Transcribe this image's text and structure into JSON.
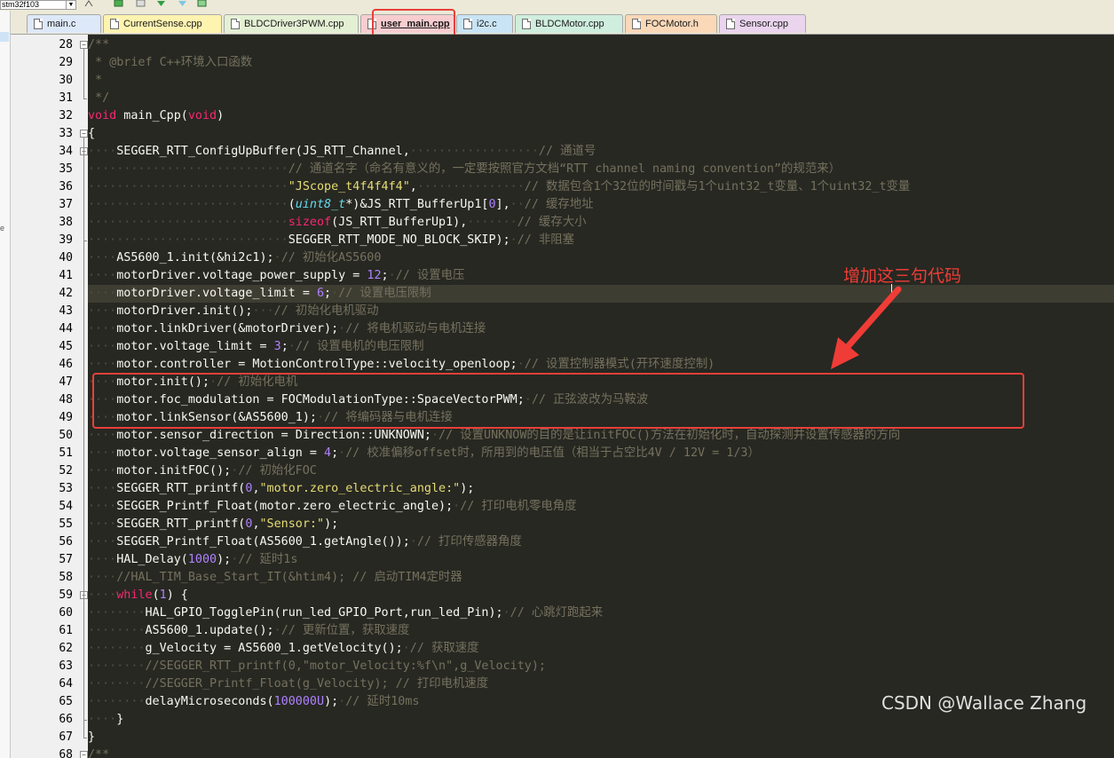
{
  "toolbar": {
    "project_select": "stm32f103"
  },
  "tabs": [
    {
      "label": "main.c",
      "color": "#dde8f8"
    },
    {
      "label": "CurrentSense.cpp",
      "color": "#fff3b0"
    },
    {
      "label": "BLDCDriver3PWM.cpp",
      "color": "#e4f0d4"
    },
    {
      "label": "user_main.cpp",
      "color": "#f8cdd0",
      "active": true
    },
    {
      "label": "i2c.c",
      "color": "#c9e4f4"
    },
    {
      "label": "BLDCMotor.cpp",
      "color": "#cfeede"
    },
    {
      "label": "FOCMotor.h",
      "color": "#fad8b8"
    },
    {
      "label": "Sensor.cpp",
      "color": "#ead4ee"
    }
  ],
  "editor": {
    "highlighted_line": 42,
    "lines": [
      {
        "n": "28",
        "fold": "open",
        "t": [
          [
            "cm",
            "/**"
          ]
        ]
      },
      {
        "n": "29",
        "t": [
          [
            "cm",
            " * @brief C++环境入口函数"
          ]
        ]
      },
      {
        "n": "30",
        "t": [
          [
            "cm",
            " *"
          ]
        ]
      },
      {
        "n": "31",
        "fold": "end",
        "t": [
          [
            "cm",
            " */"
          ]
        ]
      },
      {
        "n": "32",
        "t": [
          [
            "kw",
            "void"
          ],
          [
            "pl",
            " main_Cpp("
          ],
          [
            "kw",
            "void"
          ],
          [
            "pl",
            ")"
          ]
        ]
      },
      {
        "n": "33",
        "fold": "open",
        "t": [
          [
            "pl",
            "{"
          ]
        ]
      },
      {
        "n": "34",
        "fold": "open",
        "t": [
          [
            "ws",
            "    "
          ],
          [
            "pl",
            "SEGGER_RTT_ConfigUpBuffer(JS_RTT_Channel,"
          ],
          [
            "ws",
            "                  "
          ],
          [
            "cm",
            "// 通道号"
          ]
        ]
      },
      {
        "n": "35",
        "t": [
          [
            "ws",
            "                            "
          ],
          [
            "cm",
            "// 通道名字（命名有意义的，一定要按照官方文档“RTT channel naming convention”的规范来）"
          ]
        ]
      },
      {
        "n": "36",
        "t": [
          [
            "ws",
            "                            "
          ],
          [
            "str",
            "\"JScope_t4f4f4f4\""
          ],
          [
            "pl",
            ","
          ],
          [
            "ws",
            "               "
          ],
          [
            "cm",
            "// 数据包含1个32位的时间戳与1个uint32_t变量、1个uint32_t变量"
          ]
        ]
      },
      {
        "n": "37",
        "t": [
          [
            "ws",
            "                            "
          ],
          [
            "pl",
            "("
          ],
          [
            "ty",
            "uint8_t"
          ],
          [
            "pl",
            "*)&JS_RTT_BufferUp1["
          ],
          [
            "num",
            "0"
          ],
          [
            "pl",
            "],"
          ],
          [
            "ws",
            "  "
          ],
          [
            "cm",
            "// 缓存地址"
          ]
        ]
      },
      {
        "n": "38",
        "t": [
          [
            "ws",
            "                            "
          ],
          [
            "kw",
            "sizeof"
          ],
          [
            "pl",
            "(JS_RTT_BufferUp1),"
          ],
          [
            "ws",
            "       "
          ],
          [
            "cm",
            "// 缓存大小"
          ]
        ]
      },
      {
        "n": "39",
        "fold": "end",
        "t": [
          [
            "ws",
            "                            "
          ],
          [
            "pl",
            "SEGGER_RTT_MODE_NO_BLOCK_SKIP);"
          ],
          [
            "ws",
            " "
          ],
          [
            "cm",
            "// 非阻塞"
          ]
        ]
      },
      {
        "n": "40",
        "t": [
          [
            "ws",
            "    "
          ],
          [
            "pl",
            "AS5600_1.init(&hi2c1);"
          ],
          [
            "ws",
            " "
          ],
          [
            "cm",
            "// 初始化AS5600"
          ]
        ]
      },
      {
        "n": "41",
        "t": [
          [
            "ws",
            "    "
          ],
          [
            "pl",
            "motorDriver.voltage_power_supply = "
          ],
          [
            "num",
            "12"
          ],
          [
            "pl",
            ";"
          ],
          [
            "ws",
            " "
          ],
          [
            "cm",
            "// 设置电压"
          ]
        ]
      },
      {
        "n": "42",
        "t": [
          [
            "ws",
            "    "
          ],
          [
            "pl",
            "motorDriver.voltage_limit = "
          ],
          [
            "num",
            "6"
          ],
          [
            "pl",
            ";"
          ],
          [
            "ws",
            " "
          ],
          [
            "cm",
            "// 设置电压限制"
          ]
        ]
      },
      {
        "n": "43",
        "t": [
          [
            "ws",
            "    "
          ],
          [
            "pl",
            "motorDriver.init();"
          ],
          [
            "ws",
            "   "
          ],
          [
            "cm",
            "// 初始化电机驱动"
          ]
        ]
      },
      {
        "n": "44",
        "t": [
          [
            "ws",
            "    "
          ],
          [
            "pl",
            "motor.linkDriver(&motorDriver);"
          ],
          [
            "ws",
            " "
          ],
          [
            "cm",
            "// 将电机驱动与电机连接"
          ]
        ]
      },
      {
        "n": "45",
        "t": [
          [
            "ws",
            "    "
          ],
          [
            "pl",
            "motor.voltage_limit = "
          ],
          [
            "num",
            "3"
          ],
          [
            "pl",
            ";"
          ],
          [
            "ws",
            " "
          ],
          [
            "cm",
            "// 设置电机的电压限制"
          ]
        ]
      },
      {
        "n": "46",
        "t": [
          [
            "ws",
            "    "
          ],
          [
            "pl",
            "motor.controller = MotionControlType::velocity_openloop;"
          ],
          [
            "ws",
            " "
          ],
          [
            "cm",
            "// 设置控制器模式(开环速度控制)"
          ]
        ]
      },
      {
        "n": "47",
        "t": [
          [
            "ws",
            "    "
          ],
          [
            "pl",
            "motor.init();"
          ],
          [
            "ws",
            " "
          ],
          [
            "cm",
            "// 初始化电机"
          ]
        ]
      },
      {
        "n": "48",
        "t": [
          [
            "ws",
            "    "
          ],
          [
            "pl",
            "motor.foc_modulation = FOCModulationType::SpaceVectorPWM;"
          ],
          [
            "ws",
            " "
          ],
          [
            "cm",
            "// 正弦波改为马鞍波"
          ]
        ]
      },
      {
        "n": "49",
        "t": [
          [
            "ws",
            "    "
          ],
          [
            "pl",
            "motor.linkSensor(&AS5600_1);"
          ],
          [
            "ws",
            " "
          ],
          [
            "cm",
            "// 将编码器与电机连接"
          ]
        ]
      },
      {
        "n": "50",
        "t": [
          [
            "ws",
            "    "
          ],
          [
            "pl",
            "motor.sensor_direction = Direction::UNKNOWN;"
          ],
          [
            "ws",
            " "
          ],
          [
            "cm",
            "// 设置UNKNOW的目的是让initFOC()方法在初始化时，自动探测并设置传感器的方向"
          ]
        ]
      },
      {
        "n": "51",
        "t": [
          [
            "ws",
            "    "
          ],
          [
            "pl",
            "motor.voltage_sensor_align = "
          ],
          [
            "num",
            "4"
          ],
          [
            "pl",
            ";"
          ],
          [
            "ws",
            " "
          ],
          [
            "cm",
            "// 校准偏移offset时，所用到的电压值（相当于占空比4V / 12V = 1/3）"
          ]
        ]
      },
      {
        "n": "52",
        "t": [
          [
            "ws",
            "    "
          ],
          [
            "pl",
            "motor.initFOC();"
          ],
          [
            "ws",
            " "
          ],
          [
            "cm",
            "// 初始化FOC"
          ]
        ]
      },
      {
        "n": "53",
        "t": [
          [
            "ws",
            "    "
          ],
          [
            "pl",
            "SEGGER_RTT_printf("
          ],
          [
            "num",
            "0"
          ],
          [
            "pl",
            ","
          ],
          [
            "str",
            "\"motor.zero_electric_angle:\""
          ],
          [
            "pl",
            ");"
          ]
        ]
      },
      {
        "n": "54",
        "t": [
          [
            "ws",
            "    "
          ],
          [
            "pl",
            "SEGGER_Printf_Float(motor.zero_electric_angle);"
          ],
          [
            "ws",
            " "
          ],
          [
            "cm",
            "// 打印电机零电角度"
          ]
        ]
      },
      {
        "n": "55",
        "t": [
          [
            "ws",
            "    "
          ],
          [
            "pl",
            "SEGGER_RTT_printf("
          ],
          [
            "num",
            "0"
          ],
          [
            "pl",
            ","
          ],
          [
            "str",
            "\"Sensor:\""
          ],
          [
            "pl",
            ");"
          ]
        ]
      },
      {
        "n": "56",
        "t": [
          [
            "ws",
            "    "
          ],
          [
            "pl",
            "SEGGER_Printf_Float(AS5600_1.getAngle());"
          ],
          [
            "ws",
            " "
          ],
          [
            "cm",
            "// 打印传感器角度"
          ]
        ]
      },
      {
        "n": "57",
        "t": [
          [
            "ws",
            "    "
          ],
          [
            "pl",
            "HAL_Delay("
          ],
          [
            "num",
            "1000"
          ],
          [
            "pl",
            ");"
          ],
          [
            "ws",
            " "
          ],
          [
            "cm",
            "// 延时1s"
          ]
        ]
      },
      {
        "n": "58",
        "t": [
          [
            "ws",
            "    "
          ],
          [
            "cm",
            "//HAL_TIM_Base_Start_IT(&htim4); // 启动TIM4定时器"
          ]
        ]
      },
      {
        "n": "59",
        "fold": "open",
        "t": [
          [
            "ws",
            "    "
          ],
          [
            "kw",
            "while"
          ],
          [
            "pl",
            "("
          ],
          [
            "num",
            "1"
          ],
          [
            "pl",
            ") {"
          ]
        ]
      },
      {
        "n": "60",
        "t": [
          [
            "ws",
            "        "
          ],
          [
            "pl",
            "HAL_GPIO_TogglePin(run_led_GPIO_Port,run_led_Pin);"
          ],
          [
            "ws",
            " "
          ],
          [
            "cm",
            "// 心跳灯跑起来"
          ]
        ]
      },
      {
        "n": "61",
        "t": [
          [
            "ws",
            "        "
          ],
          [
            "pl",
            "AS5600_1.update();"
          ],
          [
            "ws",
            " "
          ],
          [
            "cm",
            "// 更新位置，获取速度"
          ]
        ]
      },
      {
        "n": "62",
        "t": [
          [
            "ws",
            "        "
          ],
          [
            "pl",
            "g_Velocity = AS5600_1.getVelocity();"
          ],
          [
            "ws",
            " "
          ],
          [
            "cm",
            "// 获取速度"
          ]
        ]
      },
      {
        "n": "63",
        "t": [
          [
            "ws",
            "        "
          ],
          [
            "cm",
            "//SEGGER_RTT_printf(0,\"motor_Velocity:%f\\n\",g_Velocity);"
          ]
        ]
      },
      {
        "n": "64",
        "t": [
          [
            "ws",
            "        "
          ],
          [
            "cm",
            "//SEGGER_Printf_Float(g_Velocity); // 打印电机速度"
          ]
        ]
      },
      {
        "n": "65",
        "t": [
          [
            "ws",
            "        "
          ],
          [
            "pl",
            "delayMicroseconds("
          ],
          [
            "num",
            "100000U"
          ],
          [
            "pl",
            ");"
          ],
          [
            "ws",
            " "
          ],
          [
            "cm",
            "// 延时10ms"
          ]
        ]
      },
      {
        "n": "66",
        "fold": "end",
        "t": [
          [
            "ws",
            "    "
          ],
          [
            "pl",
            "}"
          ]
        ]
      },
      {
        "n": "67",
        "fold": "end",
        "t": [
          [
            "pl",
            "}"
          ]
        ]
      },
      {
        "n": "68",
        "fold": "open",
        "t": [
          [
            "cm",
            "/**"
          ]
        ]
      }
    ]
  },
  "annotation": {
    "text": "增加这三句代码",
    "color": "#f03c36"
  },
  "watermark": "CSDN @Wallace Zhang",
  "colors": {
    "editor_bg": "#272822",
    "keyword": "#f92672",
    "function": "#a6e22e",
    "string": "#e6db74",
    "number": "#ae81ff",
    "comment": "#75715e",
    "type": "#66d9ef"
  }
}
